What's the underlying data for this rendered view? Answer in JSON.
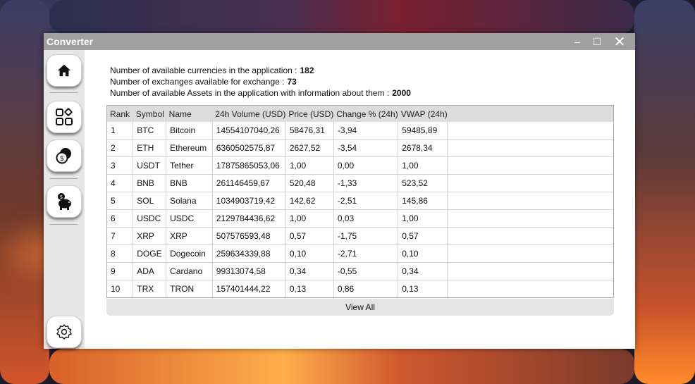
{
  "window": {
    "title": "Converter",
    "minimize": "–",
    "maximize": "☐",
    "close": "✕"
  },
  "sidebar": {
    "items": [
      {
        "name": "home",
        "icon": "home-icon"
      },
      {
        "name": "apps",
        "icon": "grid-icon"
      },
      {
        "name": "exchange",
        "icon": "coins-icon"
      },
      {
        "name": "savings",
        "icon": "piggy-bank-icon"
      },
      {
        "name": "settings",
        "icon": "gear-icon"
      }
    ]
  },
  "stats": {
    "currencies_label": "Number of available currencies in the application :",
    "currencies_value": "182",
    "exchanges_label": "Number of exchanges available for exchange :",
    "exchanges_value": "73",
    "assets_label": "Number of available Assets in the application with information about them :",
    "assets_value": "2000"
  },
  "table": {
    "columns": [
      "Rank",
      "Symbol",
      "Name",
      "24h Volume (USD)",
      "Price (USD)",
      "Change % (24h)",
      "VWAP (24h)"
    ],
    "rows": [
      [
        "1",
        "BTC",
        "Bitcoin",
        "14554107040,26",
        "58476,31",
        "-3,94",
        "59485,89"
      ],
      [
        "2",
        "ETH",
        "Ethereum",
        "6360502575,87",
        "2627,52",
        "-3,54",
        "2678,34"
      ],
      [
        "3",
        "USDT",
        "Tether",
        "17875865053,06",
        "1,00",
        "0,00",
        "1,00"
      ],
      [
        "4",
        "BNB",
        "BNB",
        "261146459,67",
        "520,48",
        "-1,33",
        "523,52"
      ],
      [
        "5",
        "SOL",
        "Solana",
        "1034903719,42",
        "142,62",
        "-2,51",
        "145,86"
      ],
      [
        "6",
        "USDC",
        "USDC",
        "2129784436,62",
        "1,00",
        "0,03",
        "1,00"
      ],
      [
        "7",
        "XRP",
        "XRP",
        "507576593,48",
        "0,57",
        "-1,75",
        "0,57"
      ],
      [
        "8",
        "DOGE",
        "Dogecoin",
        "259634339,88",
        "0,10",
        "-2,71",
        "0,10"
      ],
      [
        "9",
        "ADA",
        "Cardano",
        "99313074,58",
        "0,34",
        "-0,55",
        "0,34"
      ],
      [
        "10",
        "TRX",
        "TRON",
        "157401444,22",
        "0,13",
        "0,86",
        "0,13"
      ]
    ]
  },
  "view_all_label": "View All"
}
